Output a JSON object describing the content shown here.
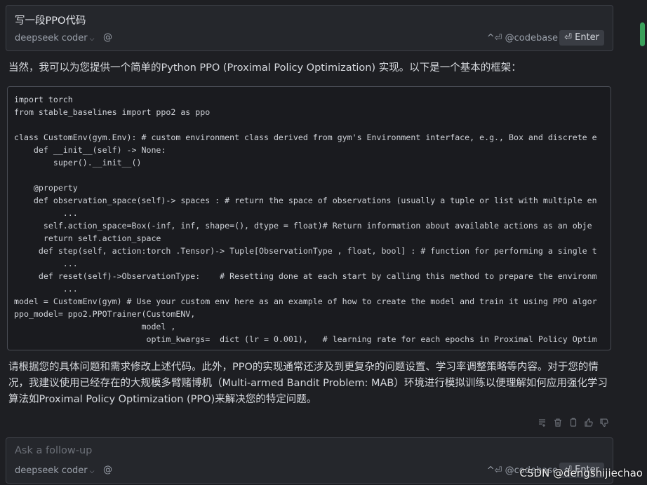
{
  "top_input": {
    "text": "写一段PPO代码",
    "model": "deepseek coder",
    "at_icon": "@",
    "shortcut": "^⏎ @codebase",
    "enter_label": "⏎ Enter"
  },
  "response": {
    "intro": "当然，我可以为您提供一个简单的Python PPO (Proximal Policy Optimization) 实现。以下是一个基本的框架：",
    "code": "import torch\nfrom stable_baselines import ppo2 as ppo\n\nclass CustomEnv(gym.Env): # custom environment class derived from gym's Environment interface, e.g., Box and discrete e\n    def __init__(self) -> None:\n        super().__init__()\n\n    @property\n    def observation_space(self)-> spaces : # return the space of observations (usually a tuple or list with multiple en\n          ...\n      self.action_space=Box(-inf, inf, shape=(), dtype = float)# Return information about available actions as an obje\n      return self.action_space\n     def step(self, action:torch .Tensor)-> Tuple[ObservationType , float, bool] : # function for performing a single t\n          ...\n     def reset(self)->ObservationType:    # Resetting done at each start by calling this method to prepare the environm\n          ...\nmodel = CustomEnv(gym) # Use your custom env here as an example of how to create the model and train it using PPO algor\nppo_model= ppo2.PPOTrainer(CustomENV,\n                          model ,\n                           optim_kwargs=  dict (lr = 0.001),   # learning rate for each epochs in Proximal Policy Optim",
    "outro": "请根据您的具体问题和需求修改上述代码。此外，PPO的实现通常还涉及到更复杂的问题设置、学习率调整策略等内容。对于您的情况，我建议使用已经存在的大规模多臂赌博机（Multi-armed Bandit Problem: MAB）环境进行模拟训练以便理解如何应用强化学习算法如Proximal Policy Optimization (PPO)来解决您的特定问题。",
    "action_icons": [
      "insert-icon",
      "trash-icon",
      "copy-icon",
      "thumbs-up-icon",
      "thumbs-down-icon"
    ]
  },
  "bottom_input": {
    "placeholder": "Ask a follow-up",
    "model": "deepseek coder",
    "at_icon": "@",
    "shortcut": "^⏎ @codebase",
    "enter_label": "⏎ Enter"
  },
  "watermark": "CSDN @dengshijiechao",
  "colors": {
    "background": "#1e1f23",
    "scroll_thumb": "#3aa05a"
  }
}
